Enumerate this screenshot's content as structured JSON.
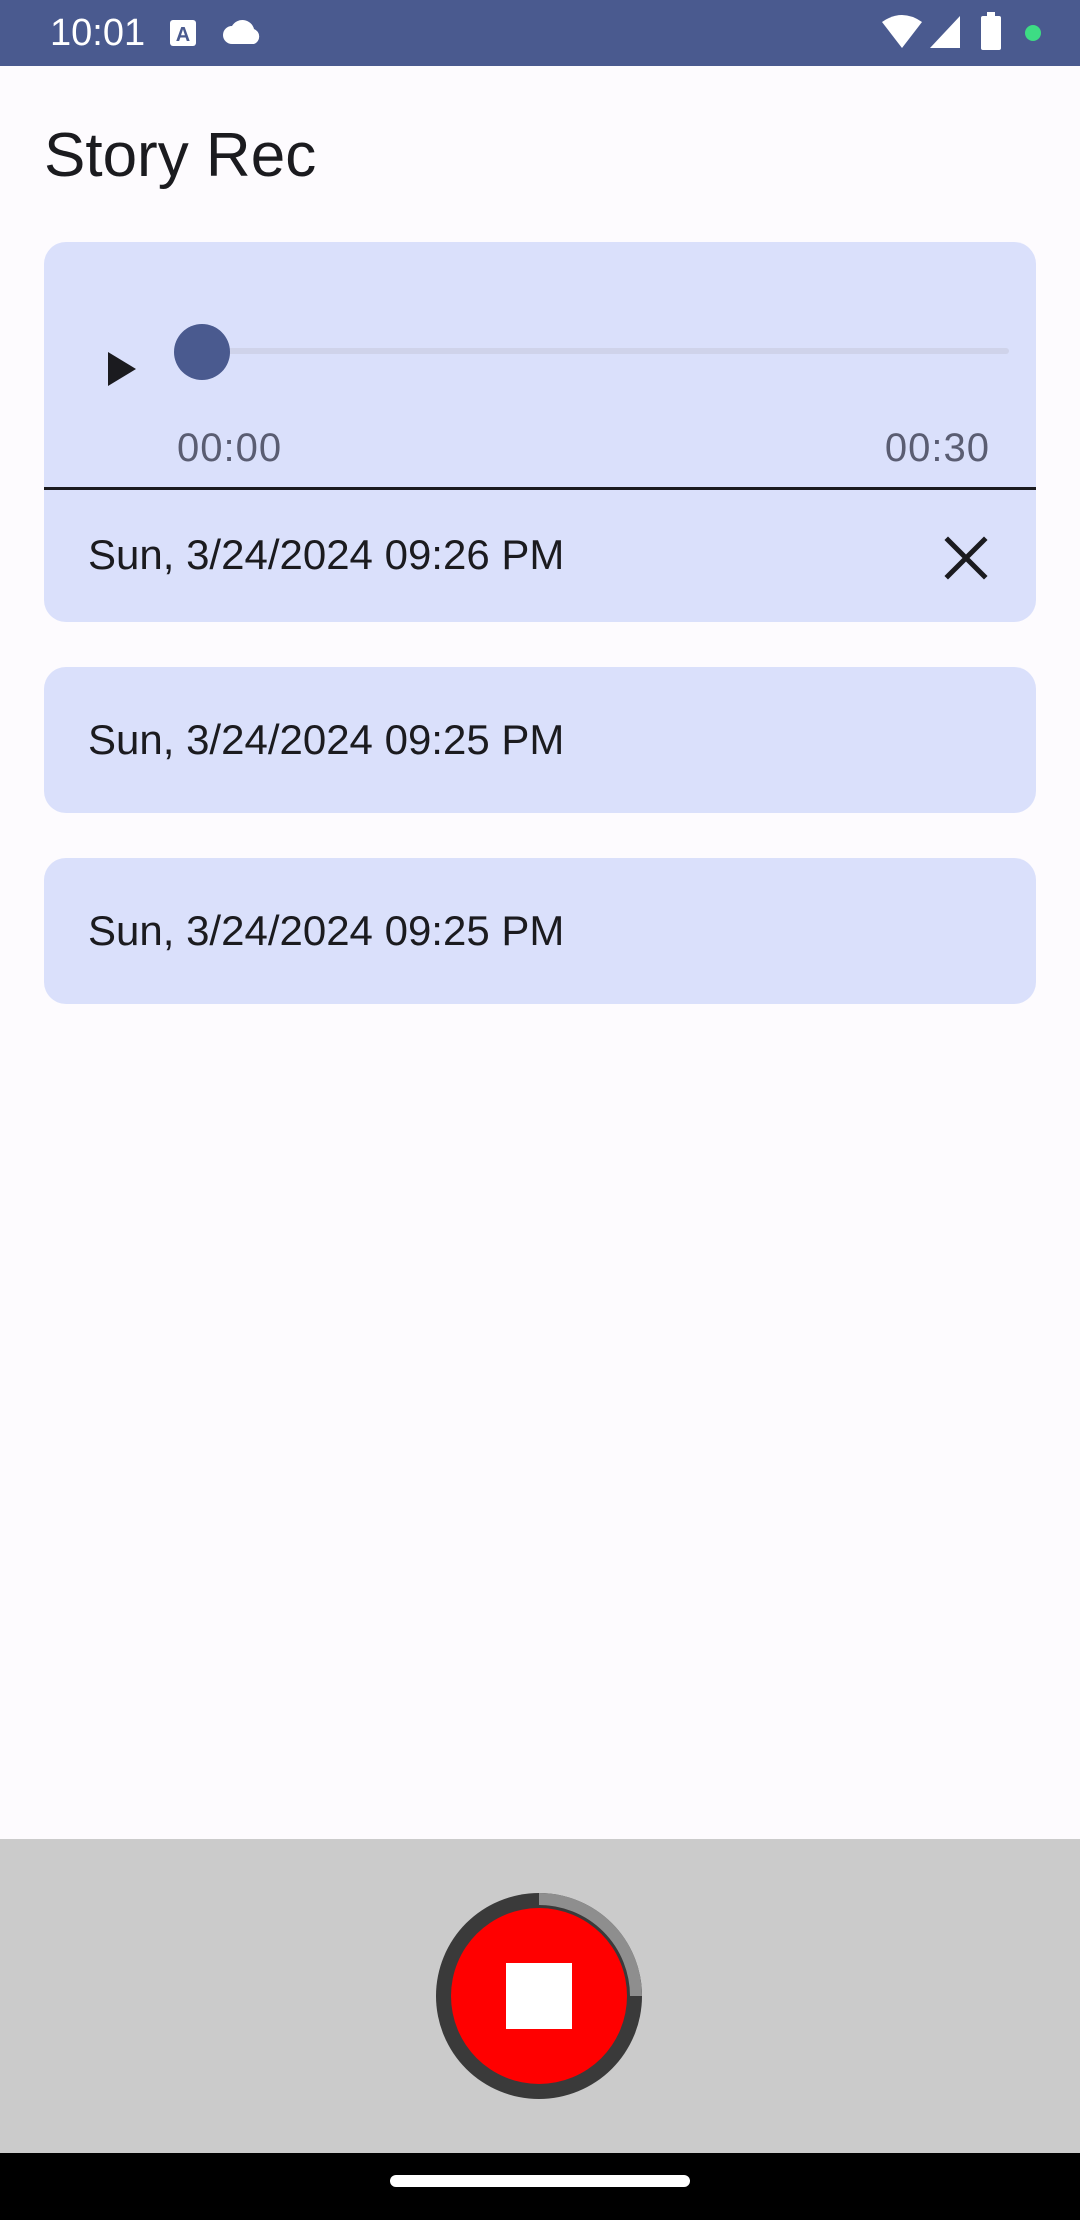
{
  "status_bar": {
    "time": "10:01",
    "icons": [
      "a-text-icon",
      "cloud-icon",
      "wifi-icon",
      "signal-icon",
      "battery-icon",
      "dot-icon"
    ],
    "dot_color": "#3ddc84"
  },
  "app": {
    "title": "Story Rec"
  },
  "player": {
    "current_time": "00:00",
    "duration": "00:30",
    "progress": 0
  },
  "recordings": [
    {
      "label": "Sun, 3/24/2024 09:26 PM",
      "expanded": true
    },
    {
      "label": "Sun, 3/24/2024 09:25 PM",
      "expanded": false
    },
    {
      "label": "Sun, 3/24/2024 09:25 PM",
      "expanded": false
    }
  ],
  "record_button": {
    "state": "recording",
    "icon": "stop-icon",
    "progress_fraction": 0.25
  },
  "colors": {
    "accent": "#4a5a8f",
    "card": "#dae0fb",
    "record_red": "#ff0000",
    "panel": "#cbcbcb"
  }
}
